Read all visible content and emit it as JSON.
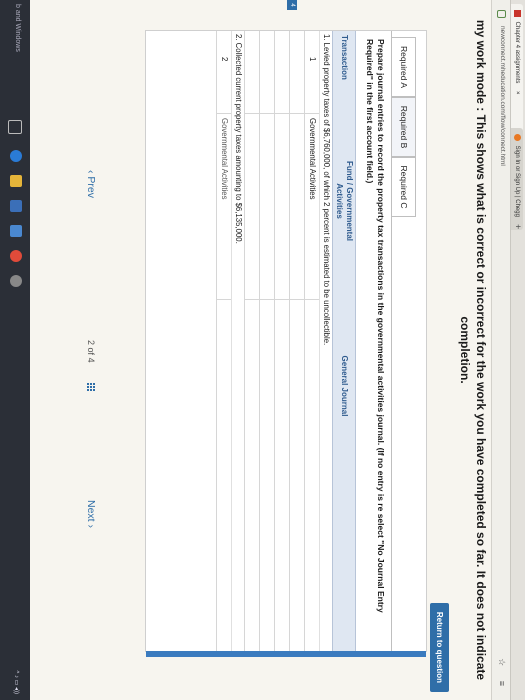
{
  "browser": {
    "tabs": [
      {
        "label": "Chapter 4 assignments"
      },
      {
        "label": "Sign In or Sign Up | Chegg"
      }
    ],
    "new_tab": "+",
    "url": "newconnect.mheducation.com/flow/connect.html",
    "toolbar_icons": "☆ ≡"
  },
  "banner": {
    "text": "my work mode : This shows what is correct or incorrect for the work you have completed so far. It does not indicate completion."
  },
  "return_button": "Return to question",
  "required_tabs": [
    "Required A",
    "Required B",
    "Required C"
  ],
  "instructions": "Prepare journal entries to record the property tax transactions in the governmental activities journal. (If no entry is re select \"No Journal Entry Required\" in the first account field.)",
  "table": {
    "headers": [
      "Transaction",
      "Fund / Governmental Activities",
      "General Journal"
    ],
    "descriptions": [
      "1. Levied property taxes of $6,760,000, of which 2 percent is estimated to be uncollectible.",
      "2. Collected current property taxes amounting to $6,135,000."
    ],
    "rows": [
      {
        "num": "1",
        "fund": "Governmental Activities"
      },
      {
        "num": "2",
        "fund": "Governmental Activities"
      }
    ],
    "left_badge": "4"
  },
  "pager": {
    "prev": "Prev",
    "page": "2",
    "of": "of",
    "total": "4",
    "next": "Next"
  },
  "taskbar": {
    "label": "b and Windows"
  }
}
